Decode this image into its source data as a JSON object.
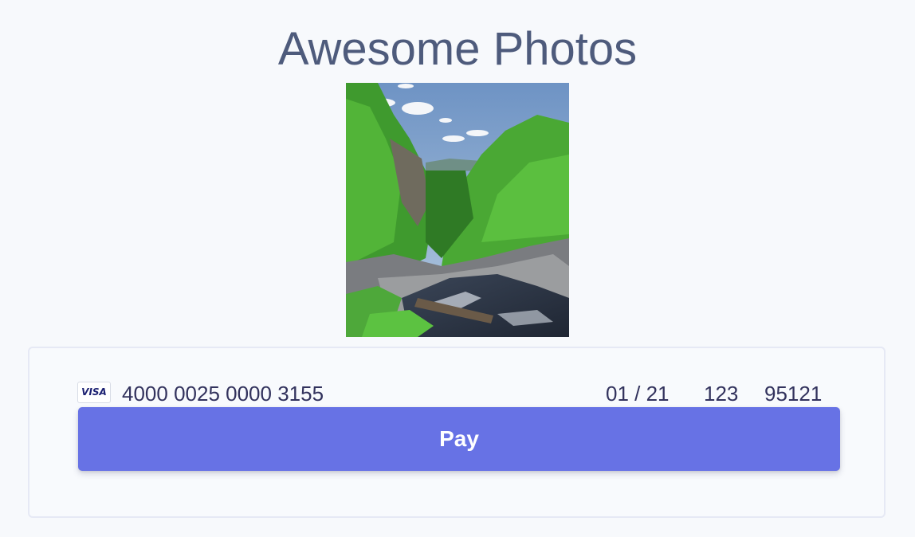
{
  "page": {
    "title": "Awesome Photos"
  },
  "photo": {
    "subject": "forest-waterfall-landscape"
  },
  "payment": {
    "card_brand": "VISA",
    "card_number": "4000 0025 0000 3155",
    "expiry": "01 / 21",
    "cvc": "123",
    "zip": "95121",
    "pay_label": "Pay",
    "accent_color": "#6772e5"
  }
}
